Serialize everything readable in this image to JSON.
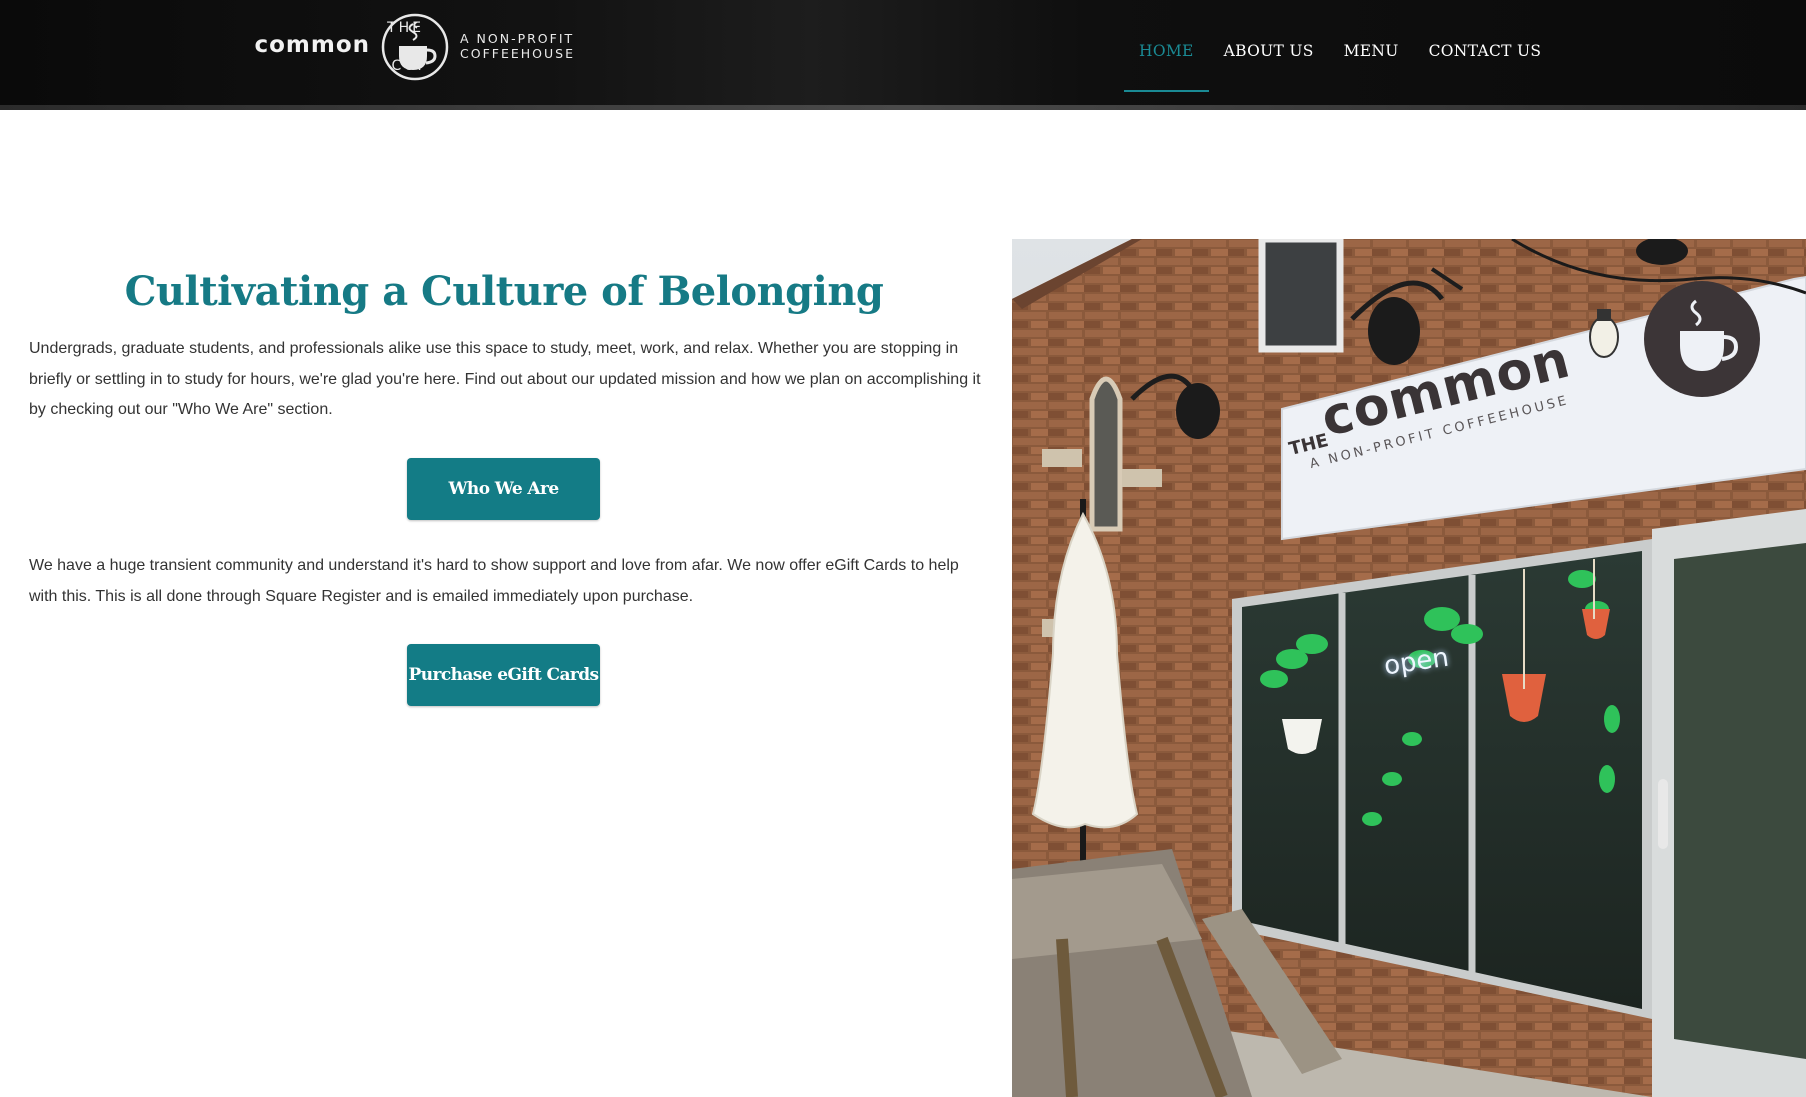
{
  "header": {
    "logo": {
      "the": "THE",
      "common": "common",
      "cup": "CUP",
      "tagline_line1": "A NON-PROFIT",
      "tagline_line2": "COFFEEHOUSE"
    },
    "nav": [
      {
        "label": "HOME",
        "active": true
      },
      {
        "label": "ABOUT US",
        "active": false
      },
      {
        "label": "MENU",
        "active": false
      },
      {
        "label": "CONTACT US",
        "active": false
      }
    ]
  },
  "main": {
    "title": "Cultivating a Culture of Belonging",
    "paragraph1": "Undergrads, graduate students, and professionals alike use this space to study, meet, work, and relax. Whether you are stopping in briefly or settling in to study for hours, we're glad you're here. Find out about our updated mission and how we plan on accomplishing it by checking out our \"Who We Are\" section.",
    "button1": "Who We Are",
    "paragraph2": "We have a huge transient community and understand it's hard to show support and love from afar. We now offer eGift Cards to help with this. This is all done through Square Register and is emailed immediately upon purchase.",
    "button2": "Purchase eGift Cards"
  },
  "photo": {
    "sign_the": "THE",
    "sign_common": "common",
    "sign_cu": "CU",
    "sign_sub": "A NON-PROFIT COFFEEHOUSE",
    "window_text": "open"
  },
  "colors": {
    "accent": "#137c86",
    "title": "#167a85",
    "nav_active": "#1a8a94",
    "header_bg": "#0f0f0f"
  }
}
